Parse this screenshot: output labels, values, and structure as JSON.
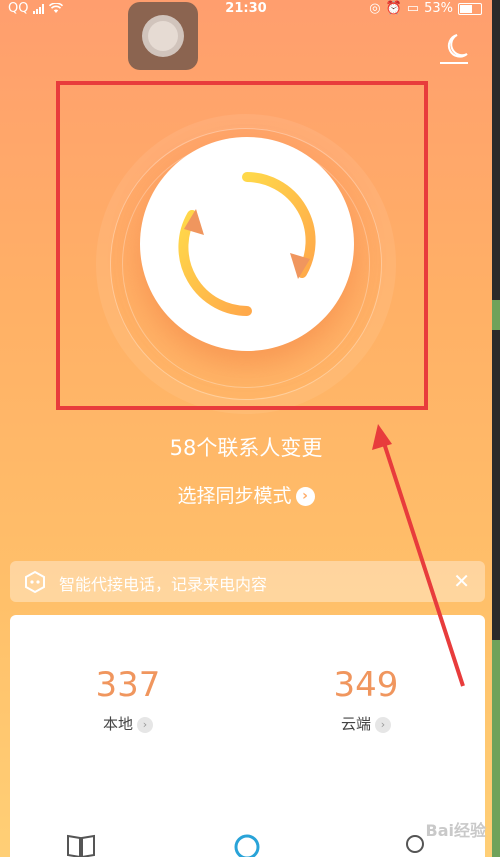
{
  "status_bar": {
    "carrier": "QQ",
    "time": "21:30",
    "battery": "53%"
  },
  "main": {
    "changes_text": "58个联系人变更",
    "sync_mode_label": "选择同步模式"
  },
  "notice": {
    "text": "智能代接电话，记录来电内容",
    "close_symbol": "✕"
  },
  "stats": [
    {
      "value": "337",
      "label": "本地"
    },
    {
      "value": "349",
      "label": "云端"
    }
  ],
  "watermark": "Bai经验",
  "colors": {
    "accent": "#f0965e",
    "highlight_box": "#e83c3c",
    "ring_yellow": "#ffcf3f"
  }
}
